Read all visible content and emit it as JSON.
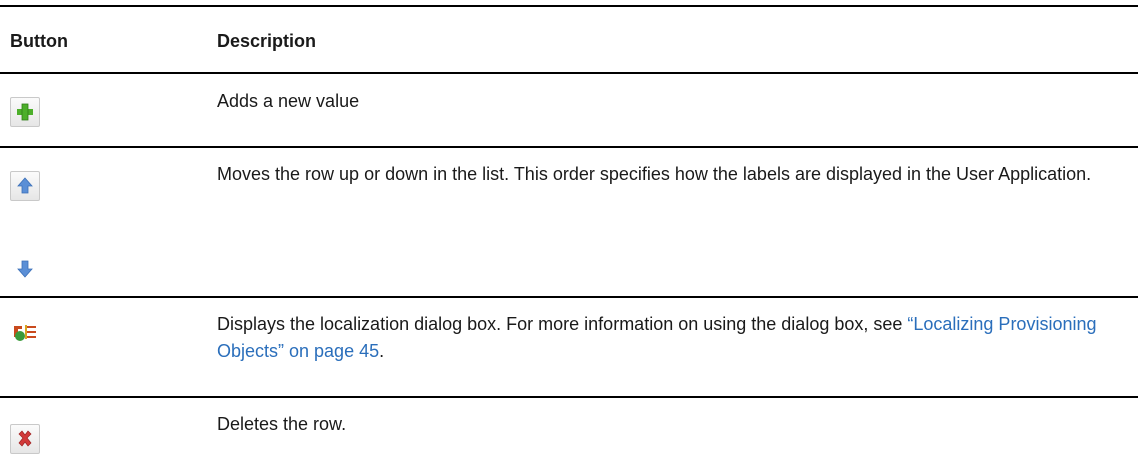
{
  "table": {
    "headers": {
      "button": "Button",
      "description": "Description"
    },
    "rows": [
      {
        "icon": "add-icon",
        "description": "Adds a new value"
      },
      {
        "icon": "move-up-icon",
        "description": "Moves the row up or down in the list. This order specifies how the labels are displayed in the User Application."
      },
      {
        "icon": "move-down-icon",
        "description": ""
      },
      {
        "icon": "localize-icon",
        "description_prefix": "Displays the localization dialog box. For more information on using the dialog box, see ",
        "description_link": "“Localizing Provisioning Objects” on page 45",
        "description_suffix": "."
      },
      {
        "icon": "delete-icon",
        "description": "Deletes the row."
      }
    ]
  },
  "colors": {
    "link": "#2a6ebb",
    "rule": "#000000",
    "add_icon": "#4caf2a",
    "arrow_icon": "#5b8fd6",
    "delete_icon": "#d23a3a"
  }
}
